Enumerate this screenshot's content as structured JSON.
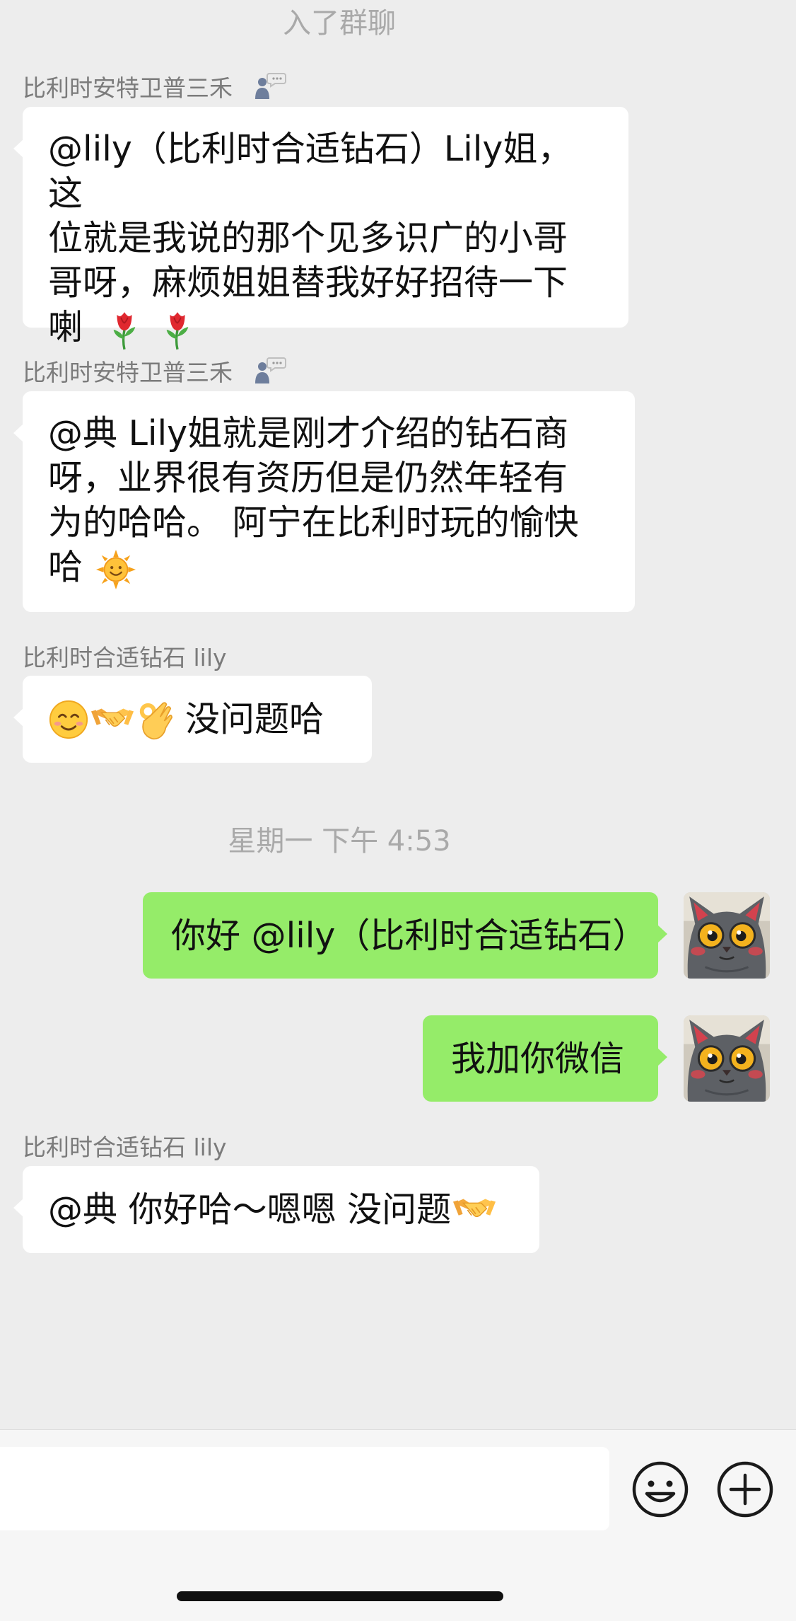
{
  "system_top": "入了群聊",
  "timestamp": "星期一 下午 4:53",
  "messages": [
    {
      "sender": "比利时安特卫普三禾",
      "line1": "@lily（比利时合适钻石）Lily姐，这",
      "line2": "位就是我说的那个见多识广的小哥",
      "line3": "哥呀，麻烦姐姐替我好好招待一下",
      "line4": "喇"
    },
    {
      "sender": "比利时安特卫普三禾",
      "line1": "@典  Lily姐就是刚才介绍的钻石商",
      "line2": "呀，业界很有资历但是仍然年轻有",
      "line3": "为的哈哈。 阿宁在比利时玩的愉快",
      "line4": "哈"
    },
    {
      "sender": "比利时合适钻石 lily",
      "text": "没问题哈"
    },
    {
      "text": "你好 @lily（比利时合适钻石）"
    },
    {
      "text": "我加你微信"
    },
    {
      "sender": "比利时合适钻石 lily",
      "text": "@典 你好哈～嗯嗯 没问题"
    }
  ],
  "icons": {
    "owner": "group-owner-icon",
    "rose": "rose-emoji",
    "sun": "sun-emoji",
    "smile": "smiling-face-emoji",
    "handshake": "handshake-emoji",
    "ok": "ok-hand-emoji",
    "avatar": "cat-avatar",
    "emoji_button": "emoji-face-icon",
    "plus_button": "plus-circle-icon"
  },
  "colors": {
    "background": "#ededed",
    "outgoing_bubble": "#95ec69",
    "incoming_bubble": "#ffffff",
    "name_text": "#7b7b7b"
  }
}
